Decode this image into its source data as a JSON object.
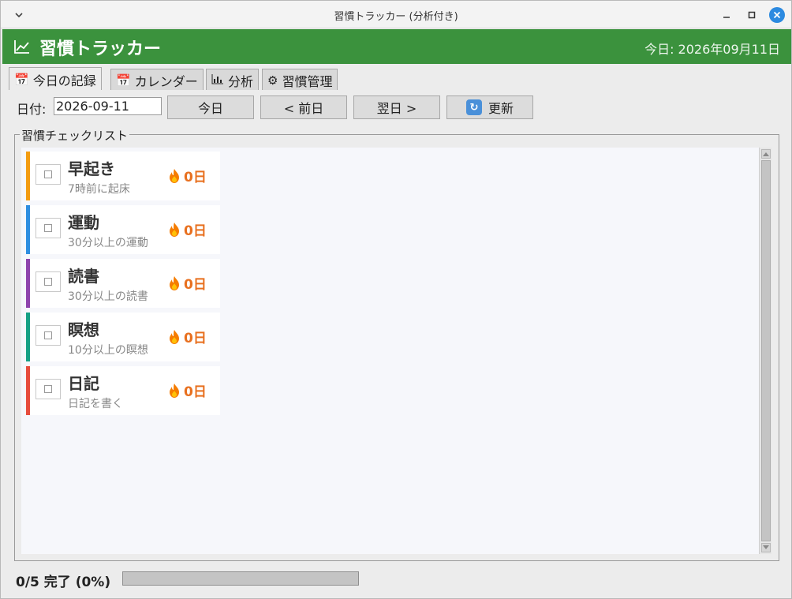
{
  "window": {
    "title": "習慣トラッカー (分析付き)"
  },
  "header": {
    "app_title": "習慣トラッカー",
    "today_label": "今日: 2026年09月11日",
    "brand_color": "#3b923d"
  },
  "tabs": [
    {
      "label": "今日の記録",
      "icon": "calendar-icon",
      "active": true
    },
    {
      "label": "カレンダー",
      "icon": "calendar-icon",
      "active": false
    },
    {
      "label": "分析",
      "icon": "bar-chart-icon",
      "active": false
    },
    {
      "label": "習慣管理",
      "icon": "gear-icon",
      "active": false
    }
  ],
  "toolbar": {
    "date_caption": "日付:",
    "date_value": "2026-09-11",
    "today_button": "今日",
    "prev_button": "< 前日",
    "next_button": "翌日 >",
    "refresh_button": "更新"
  },
  "checklist": {
    "legend": "習慣チェックリスト",
    "habits": [
      {
        "name": "早起き",
        "description": "7時前に起床",
        "streak": "0日",
        "color": "#f39c12",
        "checked": false
      },
      {
        "name": "運動",
        "description": "30分以上の運動",
        "streak": "0日",
        "color": "#2e8ee0",
        "checked": false
      },
      {
        "name": "読書",
        "description": "30分以上の読書",
        "streak": "0日",
        "color": "#8e44ad",
        "checked": false
      },
      {
        "name": "瞑想",
        "description": "10分以上の瞑想",
        "streak": "0日",
        "color": "#16a085",
        "checked": false
      },
      {
        "name": "日記",
        "description": "日記を書く",
        "streak": "0日",
        "color": "#e74c3c",
        "checked": false
      }
    ]
  },
  "status": {
    "summary": "0/5 完了 (0%)",
    "progress_fraction": 0.0
  }
}
